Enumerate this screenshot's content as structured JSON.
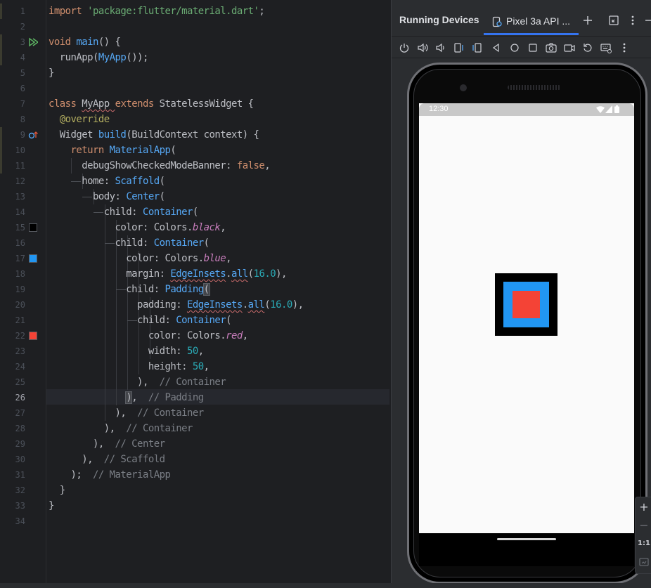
{
  "editor": {
    "line_numbers": [
      "1",
      "2",
      "3",
      "4",
      "5",
      "6",
      "7",
      "8",
      "9",
      "10",
      "11",
      "12",
      "13",
      "14",
      "15",
      "16",
      "17",
      "18",
      "19",
      "20",
      "21",
      "22",
      "23",
      "24",
      "25",
      "26",
      "27",
      "28",
      "29",
      "30",
      "31",
      "32",
      "33",
      "34"
    ],
    "current_line": "26",
    "lines": [
      [
        [
          "kw",
          "import "
        ],
        [
          "str",
          "'package:flutter/material.dart'"
        ],
        [
          "plain",
          ";"
        ]
      ],
      [],
      [
        [
          "kw",
          "void "
        ],
        [
          "fn",
          "main"
        ],
        [
          "plain",
          "() {"
        ]
      ],
      [
        [
          "plain",
          "  runApp("
        ],
        [
          "cls",
          "MyApp"
        ],
        [
          "plain",
          "());"
        ]
      ],
      [
        [
          "plain",
          "}"
        ]
      ],
      [],
      [
        [
          "kw",
          "class "
        ],
        [
          "plain",
          "MyApp "
        ],
        [
          "kw",
          "extends "
        ],
        [
          "plain",
          "StatelessWidget {"
        ]
      ],
      [
        [
          "plain",
          "  "
        ],
        [
          "anno",
          "@override"
        ]
      ],
      [
        [
          "plain",
          "  Widget "
        ],
        [
          "fn",
          "build"
        ],
        [
          "plain",
          "(BuildContext context) {"
        ]
      ],
      [
        [
          "plain",
          "    "
        ],
        [
          "kw",
          "return "
        ],
        [
          "cls",
          "MaterialApp"
        ],
        [
          "plain",
          "("
        ]
      ],
      [
        [
          "plain",
          "      debugShowCheckedModeBanner: "
        ],
        [
          "kw",
          "false"
        ],
        [
          "plain",
          ","
        ]
      ],
      [
        [
          "plain",
          "      home: "
        ],
        [
          "cls",
          "Scaffold"
        ],
        [
          "plain",
          "("
        ]
      ],
      [
        [
          "plain",
          "        body: "
        ],
        [
          "cls",
          "Center"
        ],
        [
          "plain",
          "("
        ]
      ],
      [
        [
          "plain",
          "          child: "
        ],
        [
          "cls",
          "Container"
        ],
        [
          "plain",
          "("
        ]
      ],
      [
        [
          "plain",
          "            color: Colors."
        ],
        [
          "prop",
          "black"
        ],
        [
          "plain",
          ","
        ]
      ],
      [
        [
          "plain",
          "            child: "
        ],
        [
          "cls",
          "Container"
        ],
        [
          "plain",
          "("
        ]
      ],
      [
        [
          "plain",
          "              color: Colors."
        ],
        [
          "prop",
          "blue"
        ],
        [
          "plain",
          ","
        ]
      ],
      [
        [
          "plain",
          "              margin: "
        ],
        [
          "cls",
          "EdgeInsets"
        ],
        [
          "plain",
          "."
        ],
        [
          "fn",
          "all"
        ],
        [
          "plain",
          "("
        ],
        [
          "num",
          "16.0"
        ],
        [
          "plain",
          "),"
        ]
      ],
      [
        [
          "plain",
          "              child: "
        ],
        [
          "cls",
          "Padding"
        ],
        [
          "plain",
          "("
        ]
      ],
      [
        [
          "plain",
          "                padding: "
        ],
        [
          "cls",
          "EdgeInsets"
        ],
        [
          "plain",
          "."
        ],
        [
          "fn",
          "all"
        ],
        [
          "plain",
          "("
        ],
        [
          "num",
          "16.0"
        ],
        [
          "plain",
          "),"
        ]
      ],
      [
        [
          "plain",
          "                child: "
        ],
        [
          "cls",
          "Container"
        ],
        [
          "plain",
          "("
        ]
      ],
      [
        [
          "plain",
          "                  color: Colors."
        ],
        [
          "prop",
          "red"
        ],
        [
          "plain",
          ","
        ]
      ],
      [
        [
          "plain",
          "                  width: "
        ],
        [
          "num",
          "50"
        ],
        [
          "plain",
          ","
        ]
      ],
      [
        [
          "plain",
          "                  height: "
        ],
        [
          "num",
          "50"
        ],
        [
          "plain",
          ","
        ]
      ],
      [
        [
          "plain",
          "                ),  "
        ],
        [
          "cmt",
          "// Container"
        ]
      ],
      [
        [
          "plain",
          "              ),  "
        ],
        [
          "cmt",
          "// Padding"
        ]
      ],
      [
        [
          "plain",
          "            ),  "
        ],
        [
          "cmt",
          "// Container"
        ]
      ],
      [
        [
          "plain",
          "          ),  "
        ],
        [
          "cmt",
          "// Container"
        ]
      ],
      [
        [
          "plain",
          "        ),  "
        ],
        [
          "cmt",
          "// Center"
        ]
      ],
      [
        [
          "plain",
          "      ),  "
        ],
        [
          "cmt",
          "// Scaffold"
        ]
      ],
      [
        [
          "plain",
          "    );  "
        ],
        [
          "cmt",
          "// MaterialApp"
        ]
      ],
      [
        [
          "plain",
          "  }"
        ]
      ],
      [
        [
          "plain",
          "}"
        ]
      ],
      []
    ],
    "color_swatches": {
      "black": "#000000",
      "blue": "#2196f3",
      "red": "#f44336"
    }
  },
  "panel": {
    "title": "Running Devices",
    "device_tab": "Pixel 3a API ...",
    "header_icons": [
      "add-tab-icon",
      "expand-icon",
      "more-options-icon",
      "minimize-icon"
    ],
    "toolbar_icons": [
      "power-icon",
      "volume-up-icon",
      "volume-down-icon",
      "rotate-left-icon",
      "rotate-right-icon",
      "back-icon",
      "home-icon",
      "overview-icon",
      "screenshot-icon",
      "screen-record-icon",
      "reset-icon",
      "keyboard-icon",
      "more-icon"
    ],
    "zoom": {
      "in": "+",
      "out": "−",
      "ratio": "1:1"
    }
  },
  "device": {
    "clock": "12:30",
    "status_icons": [
      "wifi-icon",
      "signal-icon",
      "battery-icon"
    ],
    "screen_bg": "#fafafa",
    "boxes": {
      "outer": "#000000",
      "middle": "#2196f3",
      "inner": "#f44336"
    }
  }
}
